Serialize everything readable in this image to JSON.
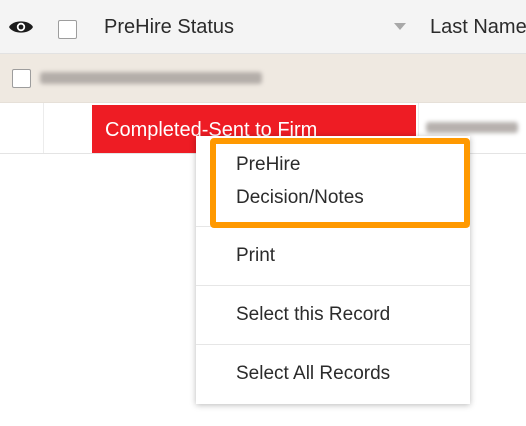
{
  "header": {
    "visibility_icon": "eye-icon",
    "status_label": "PreHire Status",
    "sort_icon": "caret-down-icon",
    "last_name_label": "Last Name"
  },
  "row": {
    "status": "Completed-Sent to Firm",
    "status_color": "#ee1c24"
  },
  "context_menu": {
    "highlight_color": "#ff9900",
    "items": [
      {
        "label_line1": "PreHire",
        "label_line2": "Decision/Notes"
      },
      {
        "label": "Print"
      },
      {
        "label": "Select this Record"
      },
      {
        "label": "Select All Records"
      }
    ]
  }
}
